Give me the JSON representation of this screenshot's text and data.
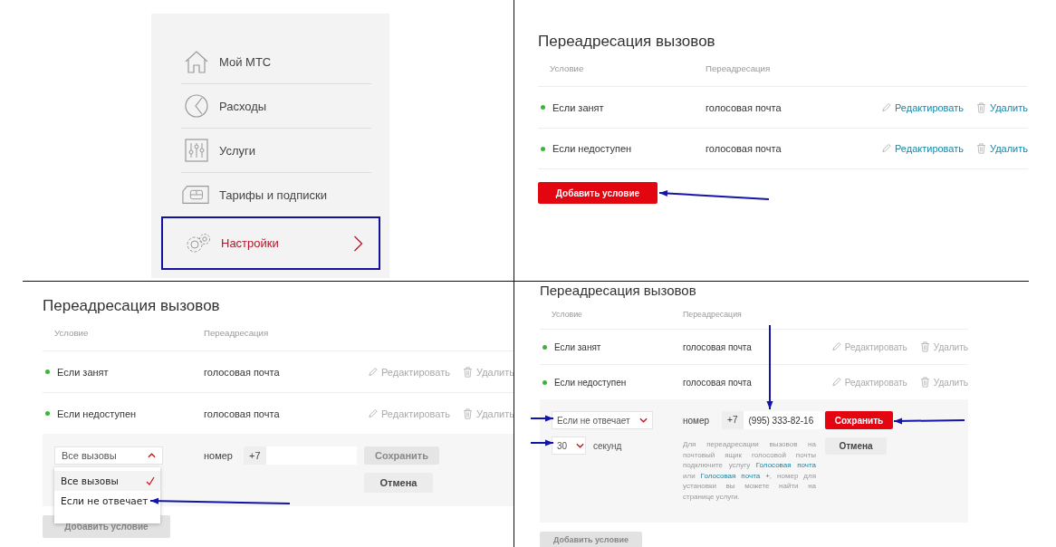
{
  "panels": [
    {
      "kind": "menu",
      "items": [
        {
          "label": "Мой МТС",
          "selected": false
        },
        {
          "label": "Расходы",
          "selected": false
        },
        {
          "label": "Услуги",
          "selected": false
        },
        {
          "label": "Тарифы и подписки",
          "selected": false
        },
        {
          "label": "Настройки",
          "selected": true
        }
      ]
    },
    {
      "kind": "forwarding",
      "title": "Переадресация вызовов",
      "columns": [
        "Условие",
        "Переадресация"
      ],
      "rows": [
        {
          "condition": "Если занят",
          "target": "голосовая почта",
          "edit": "Редактировать",
          "delete": "Удалить",
          "disabled": false
        },
        {
          "condition": "Если недоступен",
          "target": "голосовая почта",
          "edit": "Редактировать",
          "delete": "Удалить",
          "disabled": false
        }
      ],
      "add_button": {
        "label": "Добавить условие",
        "disabled": false
      }
    },
    {
      "kind": "forwarding",
      "title": "Переадресация вызовов",
      "columns": [
        "Условие",
        "Переадресация"
      ],
      "rows": [
        {
          "condition": "Если занят",
          "target": "голосовая почта",
          "edit": "Редактировать",
          "delete": "Удалить",
          "disabled": true
        },
        {
          "condition": "Если недоступен",
          "target": "голосовая почта",
          "edit": "Редактировать",
          "delete": "Удалить",
          "disabled": true
        }
      ],
      "form": {
        "condition": {
          "value": "Все вызовы",
          "expanded": true,
          "options": [
            {
              "label": "Все вызовы",
              "selected": true
            },
            {
              "label": "Если не отвечает",
              "selected": false
            }
          ]
        },
        "number_label": "номер",
        "prefix": "+7",
        "save": {
          "label": "Сохранить",
          "disabled": true
        },
        "cancel": "Отмена"
      },
      "add_button": {
        "label": "Добавить условие",
        "disabled": true
      }
    },
    {
      "kind": "forwarding",
      "title": "Переадресация вызовов",
      "columns": [
        "Условие",
        "Переадресация"
      ],
      "rows": [
        {
          "condition": "Если занят",
          "target": "голосовая почта",
          "edit": "Редактировать",
          "delete": "Удалить",
          "disabled": true
        },
        {
          "condition": "Если недоступен",
          "target": "голосовая почта",
          "edit": "Редактировать",
          "delete": "Удалить",
          "disabled": true
        }
      ],
      "form": {
        "condition": {
          "value": "Если не отвечает",
          "expanded": false
        },
        "delay": {
          "value": "30",
          "expanded": false,
          "unit": "секунд"
        },
        "number_label": "номер",
        "prefix": "+7",
        "number": "(995) 333-82-16",
        "hint": [
          {
            "kind": "text",
            "text": "Для переадресации вызовов на почтовый ящик голосовой почты подключите услугу "
          },
          {
            "kind": "link",
            "text": "Голосовая почта"
          },
          {
            "kind": "text",
            "text": " или "
          },
          {
            "kind": "link",
            "text": "Голосовая почта +"
          },
          {
            "kind": "text",
            "text": ", номер для установки вы можете найти на странице услуги."
          }
        ],
        "save": {
          "label": "Сохранить",
          "disabled": false
        },
        "cancel": "Отмена"
      },
      "add_button": {
        "label": "Добавить условие",
        "disabled": true
      }
    }
  ]
}
